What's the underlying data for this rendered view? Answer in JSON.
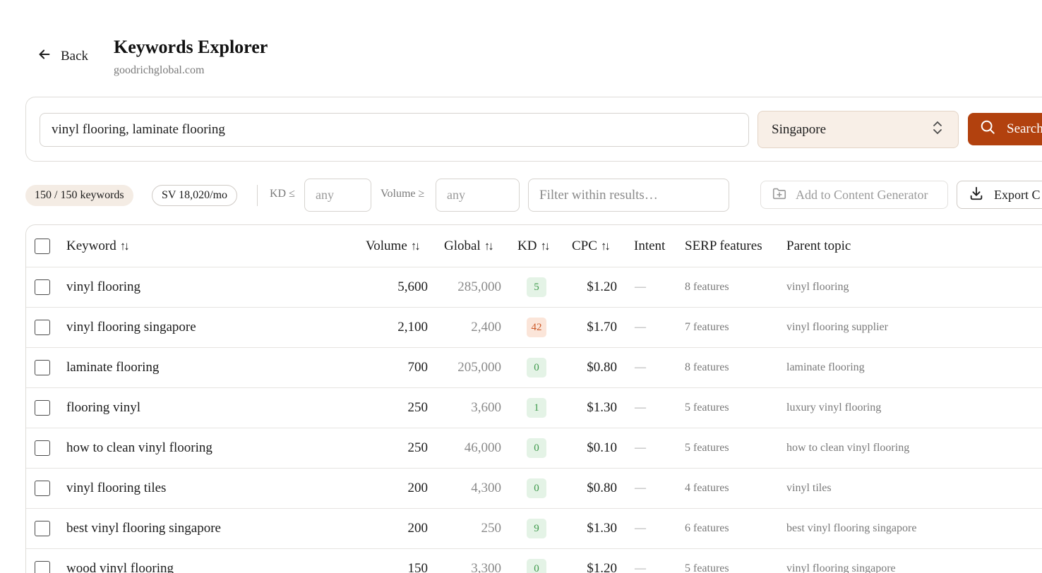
{
  "header": {
    "back_label": "Back",
    "title": "Keywords Explorer",
    "subtitle": "goodrichglobal.com"
  },
  "search": {
    "keywords_value": "vinyl flooring, laminate flooring",
    "country_value": "Singapore",
    "search_button_label": "Search"
  },
  "filters": {
    "count_pill": "150 / 150 keywords",
    "sv_pill": "SV 18,020/mo",
    "kd_label": "KD ≤",
    "kd_placeholder": "any",
    "volume_label": "Volume ≥",
    "volume_placeholder": "any",
    "filter_placeholder": "Filter within results…",
    "add_content_label": "Add to Content Generator",
    "export_label": "Export C"
  },
  "table": {
    "columns": {
      "keyword": "Keyword",
      "volume": "Volume",
      "global": "Global",
      "kd": "KD",
      "cpc": "CPC",
      "intent": "Intent",
      "serp": "SERP features",
      "parent": "Parent topic"
    },
    "rows": [
      {
        "keyword": "vinyl flooring",
        "volume": "5,600",
        "global": "285,000",
        "kd": "5",
        "kd_level": "easy",
        "cpc": "$1.20",
        "intent": "—",
        "serp": "8 features",
        "parent": "vinyl flooring"
      },
      {
        "keyword": "vinyl flooring singapore",
        "volume": "2,100",
        "global": "2,400",
        "kd": "42",
        "kd_level": "mid",
        "cpc": "$1.70",
        "intent": "—",
        "serp": "7 features",
        "parent": "vinyl flooring supplier"
      },
      {
        "keyword": "laminate flooring",
        "volume": "700",
        "global": "205,000",
        "kd": "0",
        "kd_level": "easy",
        "cpc": "$0.80",
        "intent": "—",
        "serp": "8 features",
        "parent": "laminate flooring"
      },
      {
        "keyword": "flooring vinyl",
        "volume": "250",
        "global": "3,600",
        "kd": "1",
        "kd_level": "easy",
        "cpc": "$1.30",
        "intent": "—",
        "serp": "5 features",
        "parent": "luxury vinyl flooring"
      },
      {
        "keyword": "how to clean vinyl flooring",
        "volume": "250",
        "global": "46,000",
        "kd": "0",
        "kd_level": "easy",
        "cpc": "$0.10",
        "intent": "—",
        "serp": "5 features",
        "parent": "how to clean vinyl flooring"
      },
      {
        "keyword": "vinyl flooring tiles",
        "volume": "200",
        "global": "4,300",
        "kd": "0",
        "kd_level": "easy",
        "cpc": "$0.80",
        "intent": "—",
        "serp": "4 features",
        "parent": "vinyl tiles"
      },
      {
        "keyword": "best vinyl flooring singapore",
        "volume": "200",
        "global": "250",
        "kd": "9",
        "kd_level": "easy",
        "cpc": "$1.30",
        "intent": "—",
        "serp": "6 features",
        "parent": "best vinyl flooring singapore"
      },
      {
        "keyword": "wood vinyl flooring",
        "volume": "150",
        "global": "3,300",
        "kd": "0",
        "kd_level": "easy",
        "cpc": "$1.20",
        "intent": "—",
        "serp": "5 features",
        "parent": "vinyl flooring singapore"
      }
    ]
  },
  "colors": {
    "accent": "#b2410e",
    "country_bg": "#f8efe7",
    "kd_easy_bg": "#e4f3e6",
    "kd_mid_bg": "#fbe5d9"
  }
}
